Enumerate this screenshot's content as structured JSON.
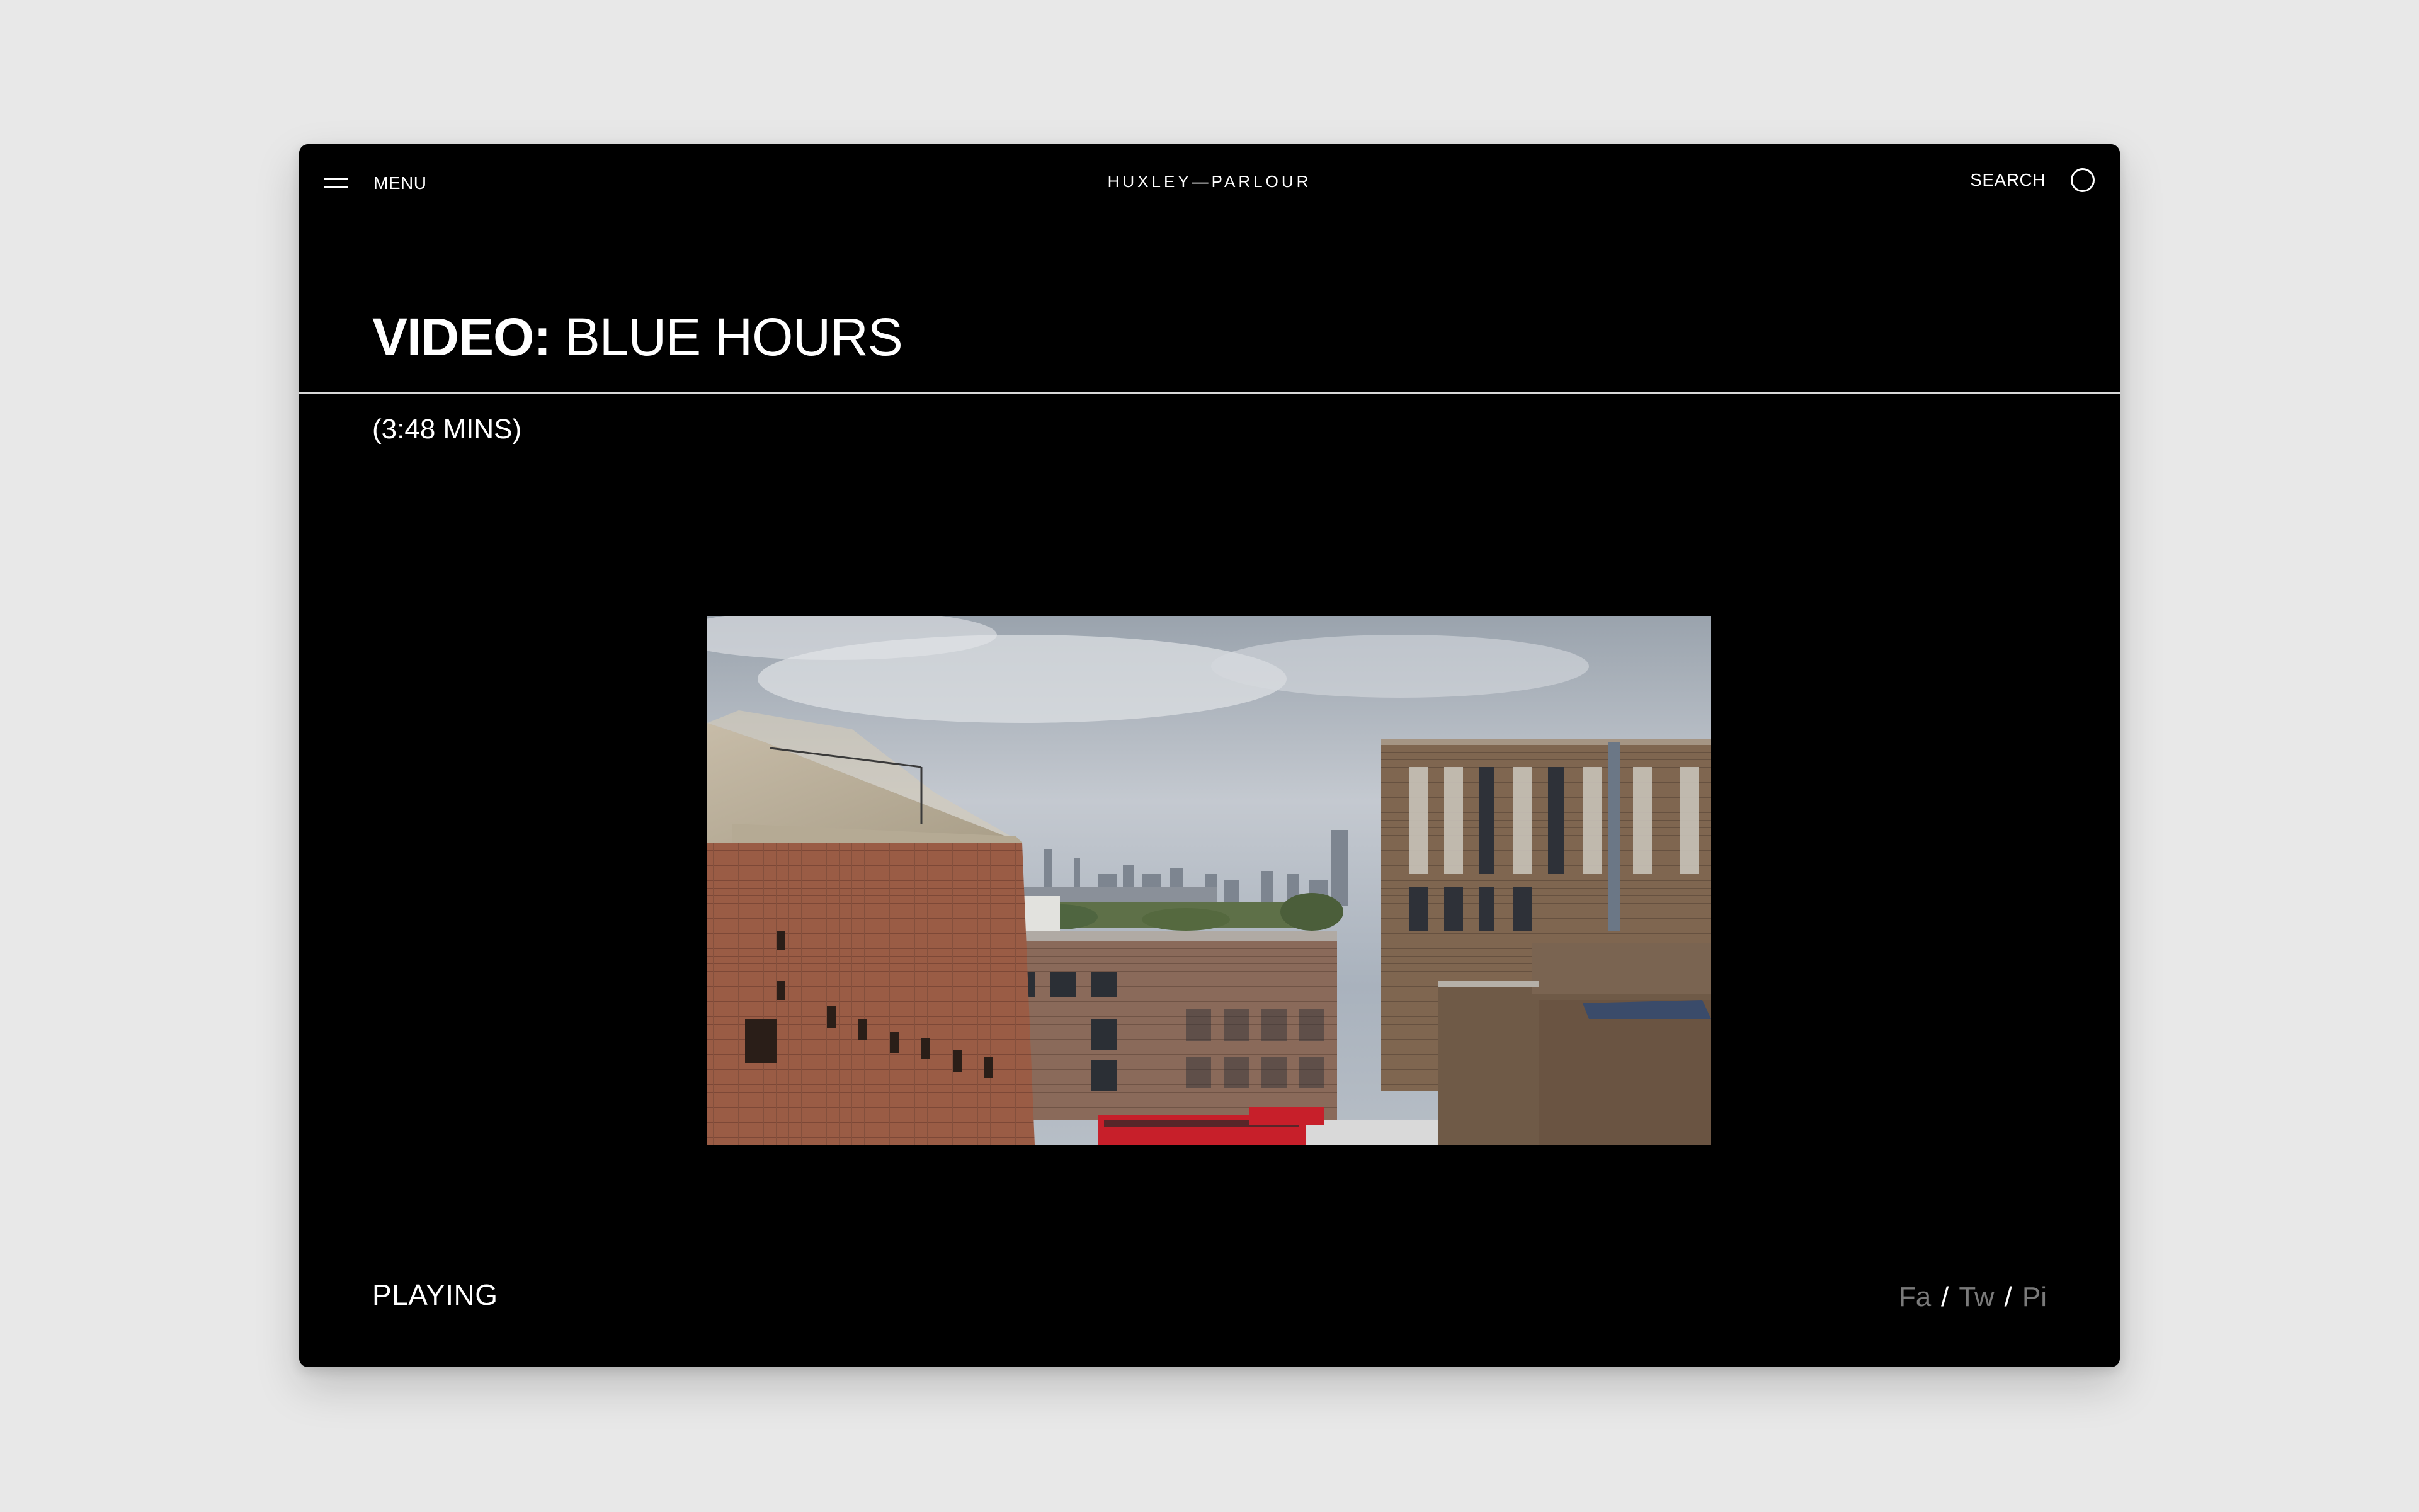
{
  "header": {
    "menu_label": "MENU",
    "logo": "HUXLEY—PARLOUR",
    "search_label": "SEARCH"
  },
  "title": {
    "prefix": "VIDEO:",
    "name": " BLUE HOURS"
  },
  "duration": "(3:48 MINS)",
  "video": {
    "state": "PLAYING",
    "thumbnail": "london-rooftops-skyline"
  },
  "social": {
    "facebook": "Fa",
    "twitter": "Tw",
    "pinterest": "Pi",
    "separator": "/"
  },
  "colors": {
    "page_bg": "#e8e8e8",
    "window_bg": "#000000",
    "text": "#ffffff",
    "muted": "#7a7a7a"
  }
}
